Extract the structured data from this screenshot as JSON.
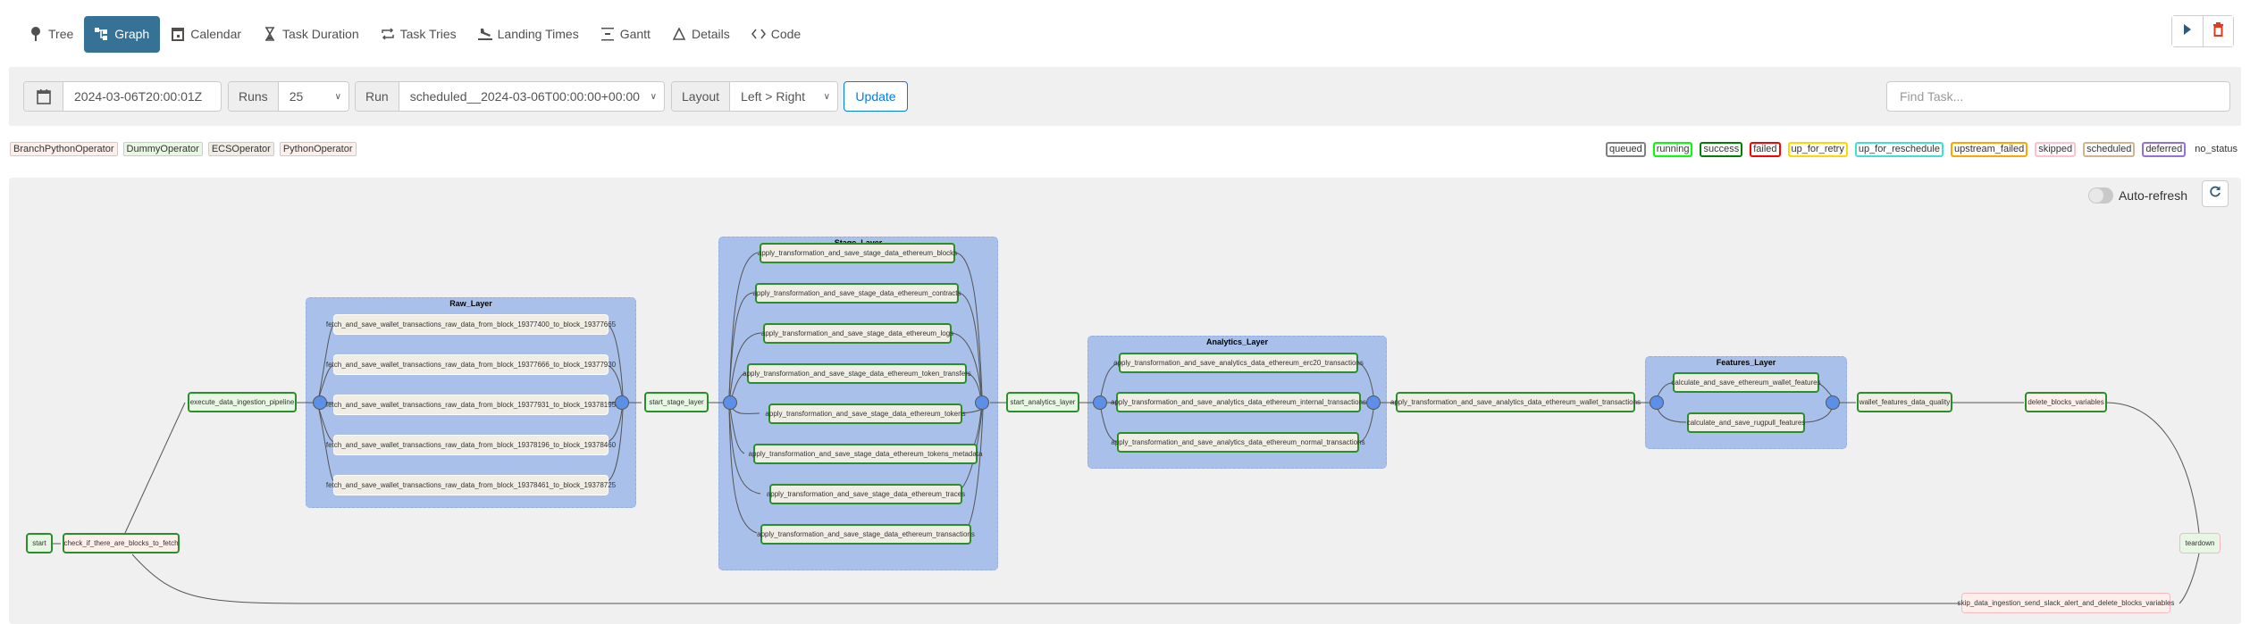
{
  "nav": {
    "tabs": [
      {
        "label": "Tree",
        "icon": "tree-icon",
        "active": false
      },
      {
        "label": "Graph",
        "icon": "graph-icon",
        "active": true
      },
      {
        "label": "Calendar",
        "icon": "calendar-icon",
        "active": false
      },
      {
        "label": "Task Duration",
        "icon": "hourglass-icon",
        "active": false
      },
      {
        "label": "Task Tries",
        "icon": "repeat-icon",
        "active": false
      },
      {
        "label": "Landing Times",
        "icon": "plane-landing-icon",
        "active": false
      },
      {
        "label": "Gantt",
        "icon": "gantt-icon",
        "active": false
      },
      {
        "label": "Details",
        "icon": "triangle-icon",
        "active": false
      },
      {
        "label": "Code",
        "icon": "code-icon",
        "active": false
      }
    ],
    "actions": {
      "trigger_icon": "play-icon",
      "delete_icon": "trash-icon"
    }
  },
  "filters": {
    "base_date": "2024-03-06T20:00:01Z",
    "runs_label": "Runs",
    "runs_value": "25",
    "run_label": "Run",
    "run_value": "scheduled__2024-03-06T00:00:00+00:00",
    "layout_label": "Layout",
    "layout_value": "Left > Right",
    "update_label": "Update",
    "find_task_placeholder": "Find Task..."
  },
  "operator_legend": [
    {
      "label": "BranchPythonOperator",
      "color": "#ffefeb"
    },
    {
      "label": "DummyOperator",
      "color": "#e8f7e4"
    },
    {
      "label": "ECSOperator",
      "color": "#f0ede4"
    },
    {
      "label": "PythonOperator",
      "color": "#ffefeb"
    }
  ],
  "state_legend": [
    {
      "label": "queued",
      "color": "#808080"
    },
    {
      "label": "running",
      "color": "#00ff00"
    },
    {
      "label": "success",
      "color": "#008000"
    },
    {
      "label": "failed",
      "color": "#ff0000"
    },
    {
      "label": "up_for_retry",
      "color": "#ffd700"
    },
    {
      "label": "up_for_reschedule",
      "color": "#40e0d0"
    },
    {
      "label": "upstream_failed",
      "color": "#ffa500"
    },
    {
      "label": "skipped",
      "color": "#ffc0cb"
    },
    {
      "label": "scheduled",
      "color": "#d2b48c"
    },
    {
      "label": "deferred",
      "color": "#9370db"
    },
    {
      "label": "no_status",
      "color": ""
    }
  ],
  "graph": {
    "auto_refresh_label": "Auto-refresh",
    "auto_refresh_on": false,
    "groups": {
      "raw": "Raw_Layer",
      "stage": "Stage_Layer",
      "analytics": "Analytics_Layer",
      "features": "Features_Layer"
    },
    "tasks": {
      "start": "start",
      "check": "check_if_there_are_blocks_to_fetch",
      "execute": "execute_data_ingestion_pipeline",
      "raw": [
        "fetch_and_save_wallet_transactions_raw_data_from_block_19377400_to_block_19377665",
        "fetch_and_save_wallet_transactions_raw_data_from_block_19377666_to_block_19377930",
        "fetch_and_save_wallet_transactions_raw_data_from_block_19377931_to_block_19378195",
        "fetch_and_save_wallet_transactions_raw_data_from_block_19378196_to_block_19378460",
        "fetch_and_save_wallet_transactions_raw_data_from_block_19378461_to_block_19378725"
      ],
      "start_stage": "start_stage_layer",
      "stage": [
        "apply_transformation_and_save_stage_data_ethereum_blocks",
        "apply_transformation_and_save_stage_data_ethereum_contracts",
        "apply_transformation_and_save_stage_data_ethereum_logs",
        "apply_transformation_and_save_stage_data_ethereum_token_transfers",
        "apply_transformation_and_save_stage_data_ethereum_tokens",
        "apply_transformation_and_save_stage_data_ethereum_tokens_metadata",
        "apply_transformation_and_save_stage_data_ethereum_traces",
        "apply_transformation_and_save_stage_data_ethereum_transactions"
      ],
      "start_analytics": "start_analytics_layer",
      "analytics": [
        "apply_transformation_and_save_analytics_data_ethereum_erc20_transactions",
        "apply_transformation_and_save_analytics_data_ethereum_internal_transactions",
        "apply_transformation_and_save_analytics_data_ethereum_normal_transactions"
      ],
      "wallet_tx": "apply_transformation_and_save_analytics_data_ethereum_wallet_transactions",
      "features": [
        "calculate_and_save_ethereum_wallet_features",
        "calculate_and_save_rugpull_features"
      ],
      "quality": "wallet_features_data_quality",
      "delete_vars": "delete_blocks_variables",
      "teardown": "teardown",
      "skip": "skip_data_ingestion_send_slack_alert_and_delete_blocks_variables"
    }
  }
}
